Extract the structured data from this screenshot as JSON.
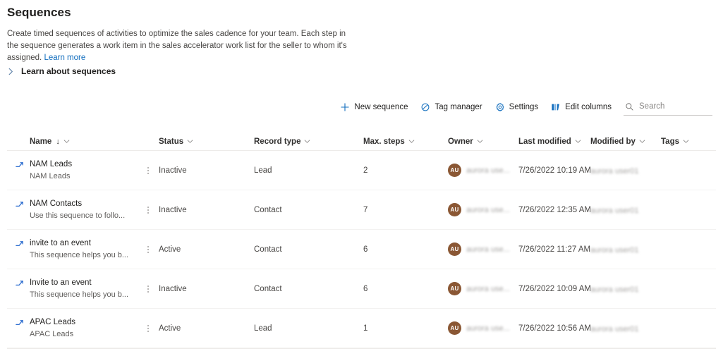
{
  "page": {
    "title": "Sequences",
    "description": "Create timed sequences of activities to optimize the sales cadence for your team. Each step in the sequence generates a work item in the sales accelerator work list for the seller to whom it's assigned.",
    "learn_more_label": "Learn more",
    "expander_label": "Learn about sequences"
  },
  "colors": {
    "accent": "#0f6cbd",
    "link": "#0f6cbd",
    "avatar": "#8a5734",
    "text_primary": "#201f1e",
    "text_secondary": "#605e5c",
    "row_divider": "#f3f2f1"
  },
  "commandbar": {
    "buttons": [
      {
        "label": "New sequence",
        "icon": "plus-icon"
      },
      {
        "label": "Tag manager",
        "icon": "tag-icon"
      },
      {
        "label": "Settings",
        "icon": "gear-icon"
      },
      {
        "label": "Edit columns",
        "icon": "columns-icon"
      }
    ],
    "search": {
      "placeholder": "Search",
      "value": "",
      "icon": "search-icon"
    }
  },
  "grid": {
    "columns": [
      {
        "label": "Name",
        "sorted": "descending",
        "sort_glyph": "↓"
      },
      {
        "label": "Status"
      },
      {
        "label": "Record type"
      },
      {
        "label": "Max. steps"
      },
      {
        "label": "Owner"
      },
      {
        "label": "Last modified"
      },
      {
        "label": "Modified by"
      },
      {
        "label": "Tags"
      }
    ],
    "rows": [
      {
        "name": "NAM Leads",
        "subtitle": "NAM Leads",
        "status": "Inactive",
        "record_type": "Lead",
        "max_steps": "2",
        "owner_initials": "AU",
        "owner_name": "aurora use...",
        "last_modified": "7/26/2022 10:19 AM",
        "modified_by": "aurora user01",
        "tags": ""
      },
      {
        "name": "NAM Contacts",
        "subtitle": "Use this sequence to follo...",
        "status": "Inactive",
        "record_type": "Contact",
        "max_steps": "7",
        "owner_initials": "AU",
        "owner_name": "aurora use...",
        "last_modified": "7/26/2022 12:35 AM",
        "modified_by": "aurora user01",
        "tags": ""
      },
      {
        "name": "invite to an event",
        "subtitle": "This sequence helps you b...",
        "status": "Active",
        "record_type": "Contact",
        "max_steps": "6",
        "owner_initials": "AU",
        "owner_name": "aurora use...",
        "last_modified": "7/26/2022 11:27 AM",
        "modified_by": "aurora user01",
        "tags": ""
      },
      {
        "name": "Invite to an event",
        "subtitle": "This sequence helps you b...",
        "status": "Inactive",
        "record_type": "Contact",
        "max_steps": "6",
        "owner_initials": "AU",
        "owner_name": "aurora use...",
        "last_modified": "7/26/2022 10:09 AM",
        "modified_by": "aurora user01",
        "tags": ""
      },
      {
        "name": "APAC Leads",
        "subtitle": "APAC Leads",
        "status": "Active",
        "record_type": "Lead",
        "max_steps": "1",
        "owner_initials": "AU",
        "owner_name": "aurora use...",
        "last_modified": "7/26/2022 10:56 AM",
        "modified_by": "aurora user01",
        "tags": ""
      }
    ]
  }
}
